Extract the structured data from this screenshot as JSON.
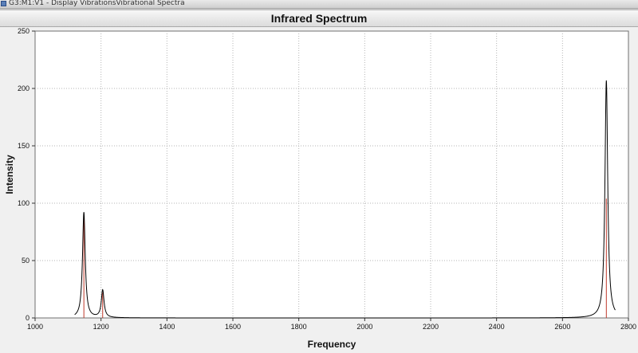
{
  "window": {
    "title": "G3:M1:V1 - Display VibrationsVibrational Spectra"
  },
  "chart_data": {
    "type": "line",
    "title": "Infrared Spectrum",
    "xlabel": "Frequency",
    "ylabel": "Intensity",
    "xlim": [
      1000,
      2800
    ],
    "ylim": [
      0,
      250
    ],
    "x_ticks": [
      1000,
      1200,
      1400,
      1600,
      1800,
      2000,
      2200,
      2400,
      2600,
      2800
    ],
    "y_ticks": [
      0,
      50,
      100,
      150,
      200,
      250
    ],
    "grid": true,
    "grid_style": "dotted",
    "spectrum_range": [
      1120,
      2760
    ],
    "linewidth": 10,
    "series": [
      {
        "kind": "spectrum",
        "color": "#000000",
        "peaks": [
          {
            "x": 1148,
            "y": 92
          },
          {
            "x": 1205,
            "y": 24
          },
          {
            "x": 2733,
            "y": 207
          }
        ]
      },
      {
        "kind": "sticks",
        "color": "#c0392b",
        "points": [
          {
            "x": 1148,
            "y": 88
          },
          {
            "x": 1205,
            "y": 22
          },
          {
            "x": 2733,
            "y": 104
          }
        ]
      }
    ]
  }
}
